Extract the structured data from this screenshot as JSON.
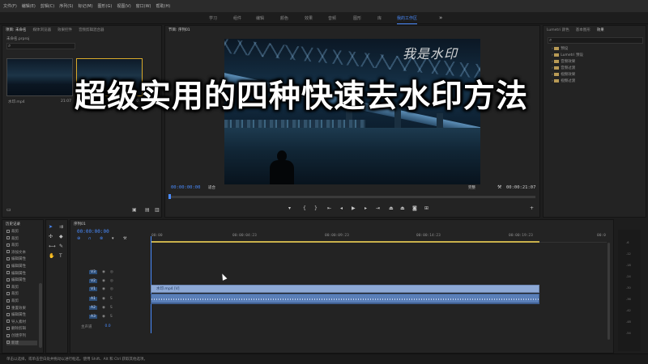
{
  "menu": [
    "文件(F)",
    "编辑(E)",
    "剪辑(C)",
    "序列(S)",
    "标记(M)",
    "图形(G)",
    "视图(V)",
    "窗口(W)",
    "帮助(H)"
  ],
  "workspaces": {
    "items": [
      "学习",
      "组件",
      "编辑",
      "颜色",
      "效果",
      "音频",
      "图形",
      "库"
    ],
    "active": "我的工作区"
  },
  "project_panel": {
    "tabs": [
      "项目: 未命名",
      "媒体浏览器",
      "效果控件",
      "音频剪辑混合器"
    ],
    "search_placeholder": "",
    "file_label": "未命名.prproj",
    "thumb1_name": "水印.mp4",
    "thumb1_dur": "21:07",
    "thumb2_name": "序列01",
    "thumb2_dur": "21:07"
  },
  "program_monitor": {
    "title": "节目: 序列01",
    "watermark_text": "我是水印",
    "timecode_left": "00:00:00:00",
    "fit": "适合",
    "quality": "完整",
    "timecode_right": "00:00:21:07"
  },
  "overlay_title": "超级实用的四种快速去水印方法",
  "lumetri": {
    "tabs": [
      "Lumetri 颜色",
      "基本图形",
      "效果"
    ],
    "items": [
      "预设",
      "Lumetri 预设",
      "音频效果",
      "音频过渡",
      "视频效果",
      "视频过渡"
    ]
  },
  "history": {
    "title": "历史记录",
    "items": [
      "裁剪",
      "裁剪",
      "裁剪",
      "添加文本",
      "编辑属性",
      "编辑属性",
      "编辑属性",
      "编辑属性",
      "裁剪",
      "裁剪",
      "裁剪",
      "重置效果",
      "编辑属性",
      "导入素材",
      "删除剪辑",
      "创建序列",
      "新建"
    ]
  },
  "timeline": {
    "tab": "序列01",
    "timecode": "00:00:00:00",
    "ruler": [
      "00:00",
      "00:00:04:23",
      "00:00:09:23",
      "00:00:14:23",
      "00:00:19:23",
      "00:0"
    ],
    "tracks": [
      "V3",
      "V2",
      "V1",
      "A1",
      "A2",
      "A3"
    ],
    "master": "主声道",
    "master_val": "0.0",
    "clip_video_label": "水印.mp4 [V]",
    "meter_labels": [
      "-6",
      "-12",
      "-18",
      "-24",
      "-30",
      "-36",
      "-42",
      "-48",
      "-54"
    ]
  },
  "status": {
    "text": "单击以选择，或单击空白处并拖动以进行框选。使用 Shift、Alt 和 Ctrl 获取其他选项。"
  }
}
